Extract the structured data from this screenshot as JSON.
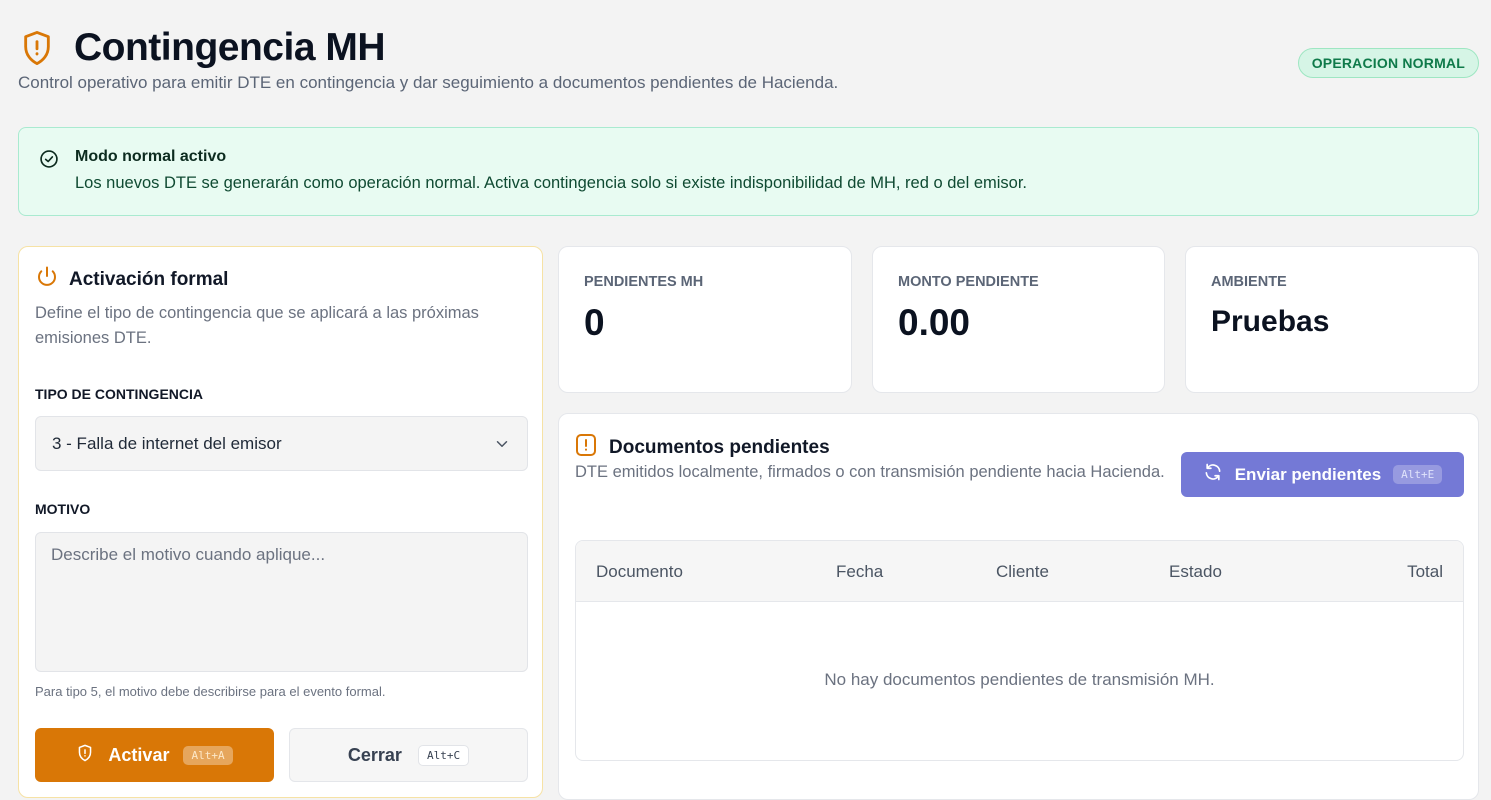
{
  "header": {
    "title": "Contingencia MH",
    "subtitle": "Control operativo para emitir DTE en contingencia y dar seguimiento a documentos pendientes de Hacienda.",
    "status_badge": "OPERACION NORMAL",
    "icon": "shield-alert-icon"
  },
  "alert": {
    "title": "Modo normal activo",
    "text": "Los nuevos DTE se generarán como operación normal. Activa contingencia solo si existe indisponibilidad de MH, red o del emisor.",
    "icon": "check-circle-icon"
  },
  "activation": {
    "title": "Activación formal",
    "icon": "power-icon",
    "description": "Define el tipo de contingencia que se aplicará a las próximas emisiones DTE.",
    "type_label": "TIPO DE CONTINGENCIA",
    "type_value": "3 - Falla de internet del emisor",
    "reason_label": "MOTIVO",
    "reason_placeholder": "Describe el motivo cuando aplique...",
    "hint": "Para tipo 5, el motivo debe describirse para el evento formal.",
    "activate_label": "Activar",
    "activate_shortcut": "Alt+A",
    "close_label": "Cerrar",
    "close_shortcut": "Alt+C"
  },
  "stats": [
    {
      "label": "PENDIENTES MH",
      "value": "0"
    },
    {
      "label": "MONTO PENDIENTE",
      "value": "0.00"
    },
    {
      "label": "AMBIENTE",
      "value": "Pruebas"
    }
  ],
  "documents": {
    "title": "Documentos pendientes",
    "icon": "alert-square-icon",
    "description": "DTE emitidos localmente, firmados o con transmisión pendiente hacia Hacienda.",
    "send_label": "Enviar pendientes",
    "send_shortcut": "Alt+E",
    "columns": [
      "Documento",
      "Fecha",
      "Cliente",
      "Estado",
      "Total"
    ],
    "empty_message": "No hay documentos pendientes de transmisión MH."
  },
  "colors": {
    "accent_orange": "#d97706",
    "accent_indigo": "#7479d6",
    "success_green": "#0f7a4a"
  }
}
